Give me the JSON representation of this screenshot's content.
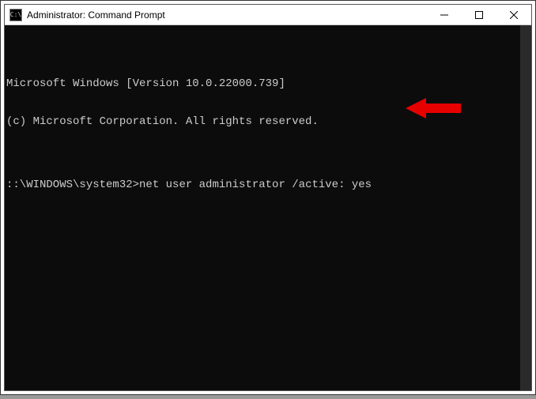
{
  "window": {
    "title": "Administrator: Command Prompt",
    "icon_label": "C:\\"
  },
  "terminal": {
    "line1": "Microsoft Windows [Version 10.0.22000.739]",
    "line2": "(c) Microsoft Corporation. All rights reserved.",
    "blank": "",
    "prompt": "::\\WINDOWS\\system32>",
    "command": "net user administrator /active: yes"
  }
}
